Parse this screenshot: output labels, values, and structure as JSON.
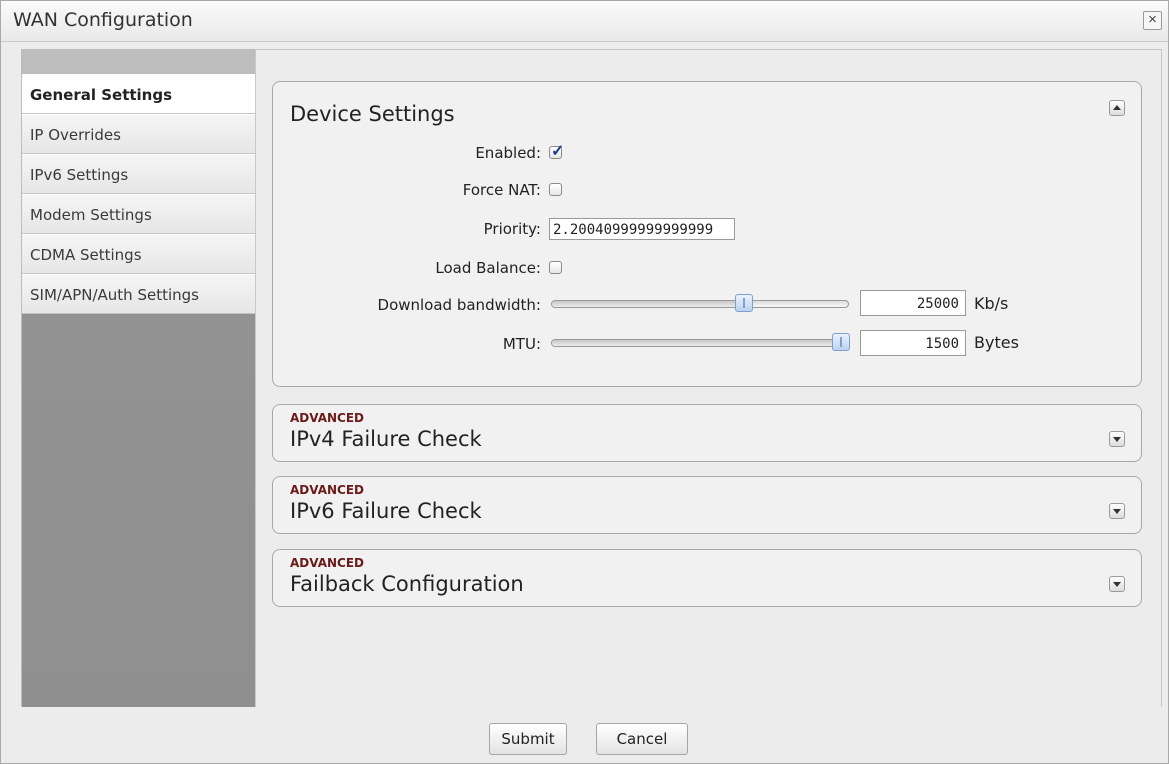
{
  "window": {
    "title": "WAN Configuration",
    "close_glyph": "×"
  },
  "sidebar": {
    "items": [
      {
        "label": "General Settings",
        "active": true
      },
      {
        "label": "IP Overrides"
      },
      {
        "label": "IPv6 Settings"
      },
      {
        "label": "Modem Settings"
      },
      {
        "label": "CDMA Settings"
      },
      {
        "label": "SIM/APN/Auth Settings"
      }
    ]
  },
  "device_settings": {
    "title": "Device Settings",
    "enabled": {
      "label": "Enabled:",
      "checked": true
    },
    "force_nat": {
      "label": "Force NAT:",
      "checked": false
    },
    "priority": {
      "label": "Priority:",
      "value": "2.20040999999999999"
    },
    "load_balance": {
      "label": "Load Balance:",
      "checked": false
    },
    "download_bandwidth": {
      "label": "Download bandwidth:",
      "value": "25000",
      "unit": "Kb/s",
      "slider_fraction": 0.65
    },
    "mtu": {
      "label": "MTU:",
      "value": "1500",
      "unit": "Bytes",
      "slider_fraction": 0.975
    }
  },
  "sections": [
    {
      "tag": "ADVANCED",
      "title": "IPv4 Failure Check"
    },
    {
      "tag": "ADVANCED",
      "title": "IPv6 Failure Check"
    },
    {
      "tag": "ADVANCED",
      "title": "Failback Configuration"
    }
  ],
  "footer": {
    "submit_label": "Submit",
    "cancel_label": "Cancel"
  }
}
